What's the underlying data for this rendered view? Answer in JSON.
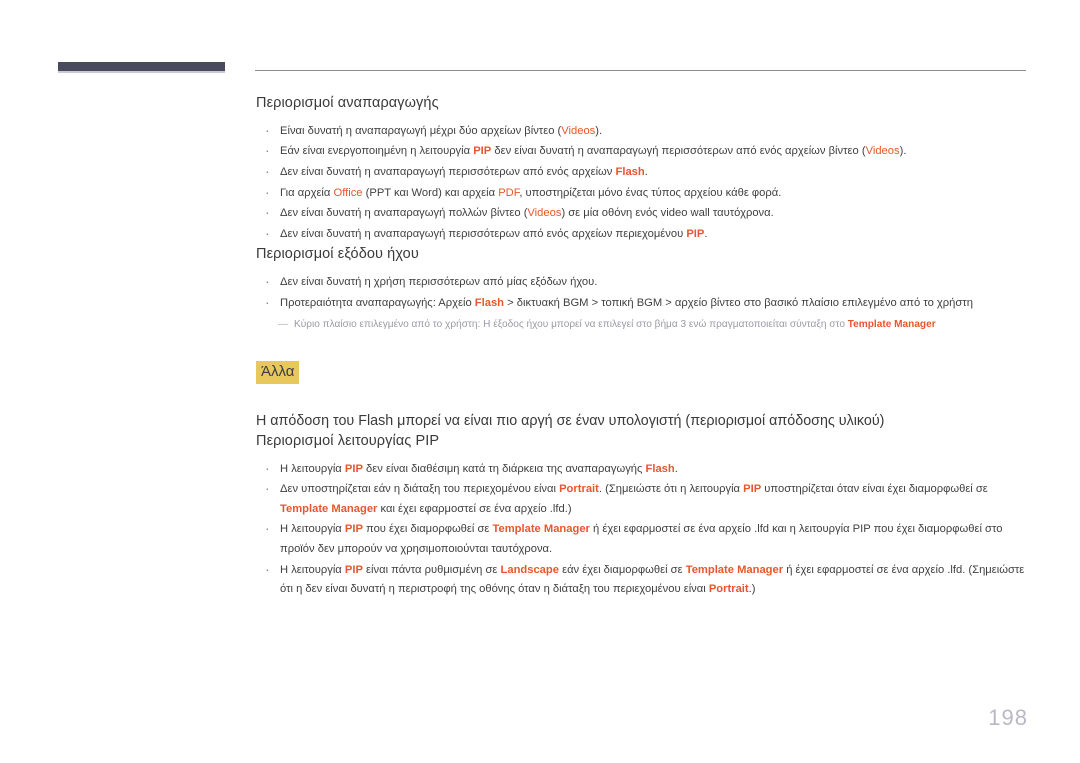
{
  "page": {
    "number": "198",
    "accent_color": "#e8562c",
    "highlight_color": "#e8c85c",
    "tab_color": "#4a4a5e",
    "note_color": "#9a9aa6"
  },
  "sections": [
    {
      "title": "Περιορισμοί αναπαραγωγής",
      "bullets": [
        [
          {
            "t": "Είναι δυνατή η αναπαραγωγή μέχρι δύο αρχείων βίντεο ("
          },
          {
            "t": "Videos",
            "s": "hl"
          },
          {
            "t": ")."
          }
        ],
        [
          {
            "t": "Εάν είναι ενεργοποιημένη η λειτουργία "
          },
          {
            "t": "PIP",
            "s": "hl-b"
          },
          {
            "t": " δεν είναι δυνατή η αναπαραγωγή περισσότερων από ενός αρχείων βίντεο ("
          },
          {
            "t": "Videos",
            "s": "hl"
          },
          {
            "t": ")."
          }
        ],
        [
          {
            "t": "Δεν είναι δυνατή η αναπαραγωγή περισσότερων από ενός αρχείων "
          },
          {
            "t": "Flash",
            "s": "hl-b"
          },
          {
            "t": "."
          }
        ],
        [
          {
            "t": "Για αρχεία "
          },
          {
            "t": "Office",
            "s": "hl"
          },
          {
            "t": " (PPT και Word) και αρχεία "
          },
          {
            "t": "PDF",
            "s": "hl"
          },
          {
            "t": ", υποστηρίζεται μόνο ένας τύπος αρχείου κάθε φορά."
          }
        ],
        [
          {
            "t": "Δεν είναι δυνατή η αναπαραγωγή πολλών βίντεο ("
          },
          {
            "t": "Videos",
            "s": "hl"
          },
          {
            "t": ") σε μία οθόνη ενός video wall ταυτόχρονα."
          }
        ],
        [
          {
            "t": "Δεν είναι δυνατή η αναπαραγωγή περισσότερων από ενός αρχείων περιεχομένου "
          },
          {
            "t": "PIP",
            "s": "hl-b"
          },
          {
            "t": "."
          }
        ]
      ]
    },
    {
      "title": "Περιορισμοί εξόδου ήχου",
      "bullets": [
        [
          {
            "t": "Δεν είναι δυνατή η χρήση περισσότερων από μίας εξόδων ήχου."
          }
        ],
        [
          {
            "t": "Προτεραιότητα αναπαραγωγής: Αρχείο "
          },
          {
            "t": "Flash",
            "s": "hl-b"
          },
          {
            "t": " > δικτυακή BGM > τοπική BGM > αρχείο βίντεο στο βασικό πλαίσιο επιλεγμένο από το χρήστη"
          }
        ]
      ],
      "note": {
        "dash": "―",
        "parts": [
          {
            "t": "Κύριο πλαίσιο επιλεγμένο από το χρήστη: Η έξοδος ήχου μπορεί να επιλεγεί στο βήμα 3 ενώ πραγματοποιείται σύνταξη στο "
          },
          {
            "t": "Template Manager",
            "s": "hl"
          }
        ]
      }
    }
  ],
  "chapter_chip": "Άλλα",
  "paragraph": "Η απόδοση του Flash μπορεί να είναι πιο αργή σε έναν υπολογιστή (περιορισμοί απόδοσης υλικού)",
  "pip_section": {
    "title": "Περιορισμοί λειτουργίας PIP",
    "bullets": [
      [
        {
          "t": "Η λειτουργία "
        },
        {
          "t": "PIP",
          "s": "hl-b"
        },
        {
          "t": " δεν είναι διαθέσιμη κατά τη διάρκεια της αναπαραγωγής "
        },
        {
          "t": "Flash",
          "s": "hl-b"
        },
        {
          "t": "."
        }
      ],
      [
        {
          "t": "Δεν υποστηρίζεται εάν η διάταξη του περιεχομένου είναι "
        },
        {
          "t": "Portrait",
          "s": "hl-b"
        },
        {
          "t": ".  (Σημειώστε ότι η λειτουργία "
        },
        {
          "t": "PIP",
          "s": "hl-b"
        },
        {
          "t": " υποστηρίζεται όταν είναι έχει διαμορφωθεί σε "
        },
        {
          "t": "Template Manager",
          "s": "hl-b"
        },
        {
          "t": " και έχει εφαρμοστεί σε ένα αρχείο .lfd.)"
        }
      ],
      [
        {
          "t": "Η λειτουργία "
        },
        {
          "t": "PIP",
          "s": "hl-b"
        },
        {
          "t": " που έχει διαμορφωθεί σε "
        },
        {
          "t": "Template Manager",
          "s": "hl-b"
        },
        {
          "t": " ή έχει εφαρμοστεί σε ένα αρχείο .lfd και η λειτουργία PIP που έχει διαμορφωθεί στο προϊόν δεν μπορούν να χρησιμοποιούνται ταυτόχρονα."
        }
      ],
      [
        {
          "t": "Η λειτουργία "
        },
        {
          "t": "PIP",
          "s": "hl-b"
        },
        {
          "t": " είναι πάντα ρυθμισμένη σε "
        },
        {
          "t": "Landscape",
          "s": "hl-b"
        },
        {
          "t": " εάν έχει διαμορφωθεί σε "
        },
        {
          "t": "Template Manager",
          "s": "hl-b"
        },
        {
          "t": " ή έχει εφαρμοστεί σε ένα αρχείο .lfd. (Σημειώστε ότι η δεν είναι δυνατή η περιστροφή της οθόνης όταν η διάταξη του περιεχομένου είναι "
        },
        {
          "t": "Portrait",
          "s": "hl-b"
        },
        {
          "t": ".)"
        }
      ]
    ]
  }
}
